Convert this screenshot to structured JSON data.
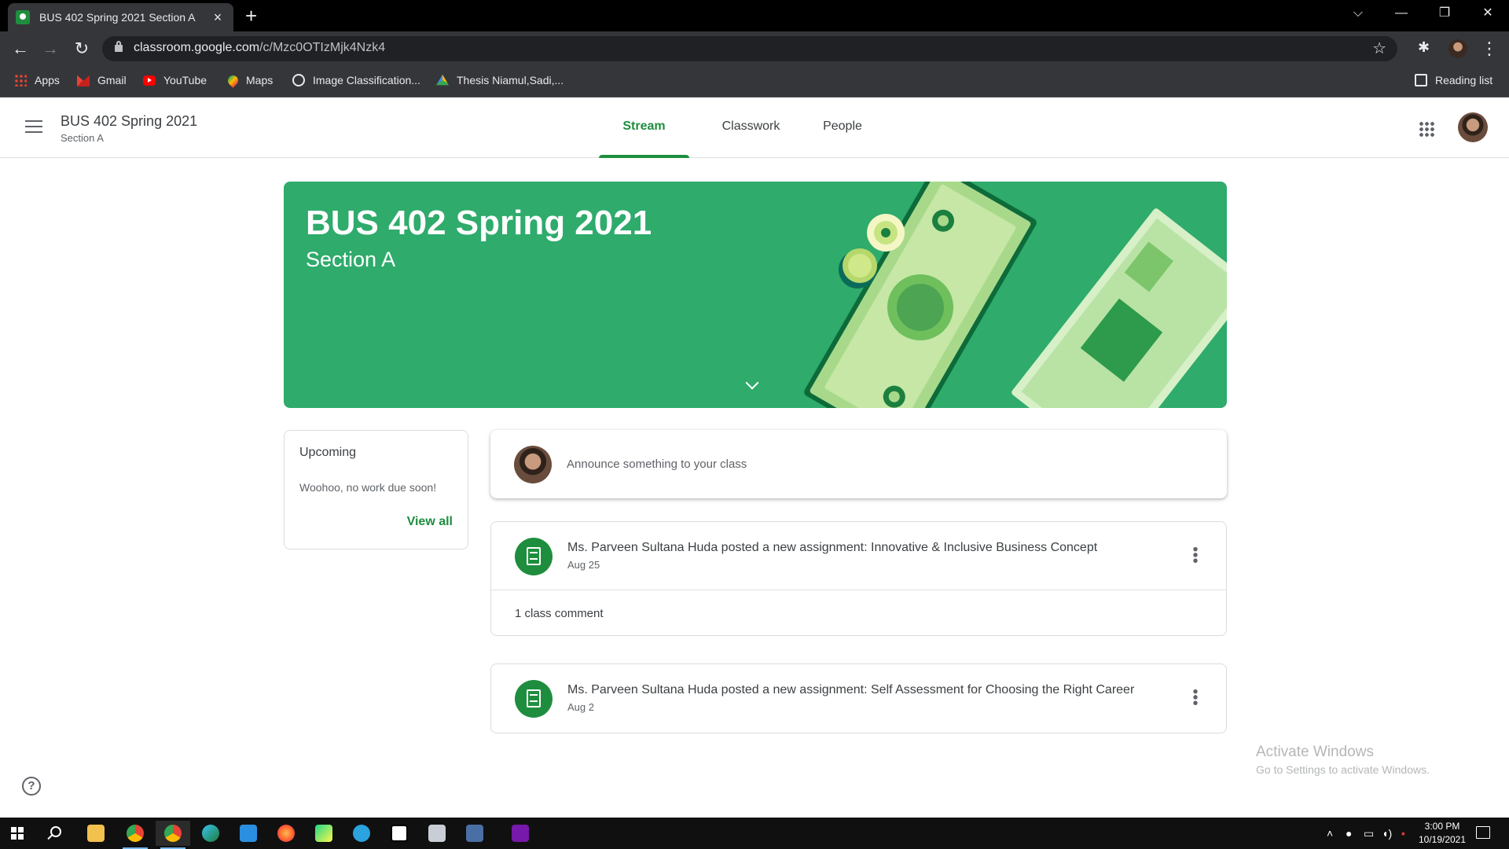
{
  "browser": {
    "tab_title": "BUS 402 Spring 2021 Section A",
    "url_host": "classroom.google.com",
    "url_path": "/c/Mzc0OTIzMjk4Nzk4",
    "bookmarks": [
      {
        "label": "Apps",
        "icon": "apps-grid-icon"
      },
      {
        "label": "Gmail",
        "icon": "gmail-icon"
      },
      {
        "label": "YouTube",
        "icon": "youtube-icon"
      },
      {
        "label": "Maps",
        "icon": "maps-icon"
      },
      {
        "label": "Image Classification...",
        "icon": "globe-icon"
      },
      {
        "label": "Thesis Niamul,Sadi,...",
        "icon": "drive-icon"
      }
    ],
    "reading_list": "Reading list"
  },
  "header": {
    "course_title": "BUS 402 Spring 2021",
    "section": "Section A",
    "tabs": [
      {
        "label": "Stream",
        "active": true
      },
      {
        "label": "Classwork",
        "active": false
      },
      {
        "label": "People",
        "active": false
      }
    ]
  },
  "banner": {
    "title": "BUS 402 Spring 2021",
    "subtitle": "Section A",
    "color": "#2fab6c"
  },
  "upcoming": {
    "title": "Upcoming",
    "empty_text": "Woohoo, no work due soon!",
    "view_all": "View all"
  },
  "announce": {
    "placeholder": "Announce something to your class"
  },
  "posts": [
    {
      "title": "Ms. Parveen Sultana Huda posted a new assignment: Innovative & Inclusive Business Concept",
      "date": "Aug 25",
      "comments": "1 class comment"
    },
    {
      "title": "Ms. Parveen Sultana Huda posted a new assignment: Self Assessment for Choosing the Right Career",
      "date": "Aug 2",
      "comments": ""
    }
  ],
  "watermark": {
    "title": "Activate Windows",
    "subtitle": "Go to Settings to activate Windows."
  },
  "taskbar": {
    "time": "3:00 PM",
    "date": "10/19/2021"
  },
  "colors": {
    "accent": "#1e8e3e",
    "chrome_dark": "#35363a"
  }
}
